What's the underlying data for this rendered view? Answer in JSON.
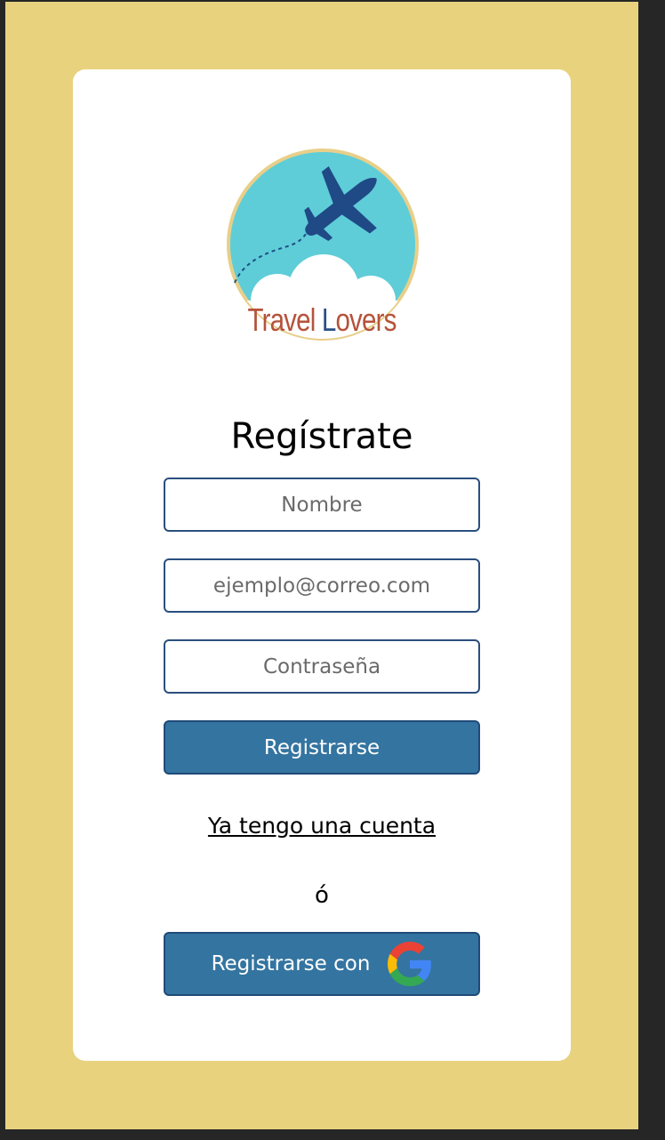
{
  "brand": {
    "name_part_1": "Travel ",
    "name_part_2": "L",
    "name_part_3": "overs",
    "logo_icon": "airplane-over-clouds"
  },
  "form": {
    "title": "Regístrate",
    "name_placeholder": "Nombre",
    "email_placeholder": "ejemplo@correo.com",
    "password_placeholder": "Contraseña",
    "submit_label": "Registrarse"
  },
  "links": {
    "have_account": "Ya tengo una cuenta",
    "or_separator": "ó"
  },
  "google": {
    "label": "Registrarse con",
    "icon": "google-icon"
  },
  "colors": {
    "backdrop": "#e8d27e",
    "card": "#ffffff",
    "button": "#3474a0",
    "button_border": "#1f4a78",
    "logo_sky": "#5ecdd8",
    "logo_ring": "#e8cf8a",
    "brand_red": "#b5533b",
    "brand_blue": "#2a4f86"
  }
}
